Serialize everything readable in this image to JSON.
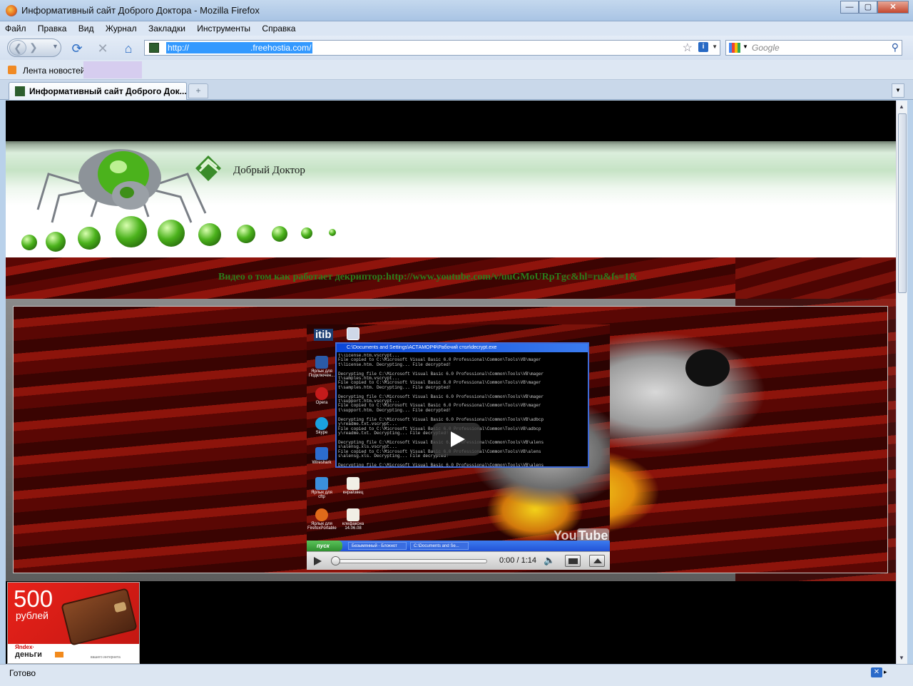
{
  "window": {
    "title": "Информативный сайт Доброго Доктора - Mozilla Firefox",
    "buttons": {
      "minimize": "—",
      "maximize": "▢",
      "close": "✕"
    }
  },
  "menu": [
    "Файл",
    "Правка",
    "Вид",
    "Журнал",
    "Закладки",
    "Инструменты",
    "Справка"
  ],
  "nav": {
    "url_prefix": "http://",
    "url_suffix": ".freehostia.com/",
    "search_placeholder": "Google"
  },
  "bookmarks": {
    "feed_label": "Лента новостей"
  },
  "tabs": [
    {
      "title": "Информативный сайт Доброго Док..."
    }
  ],
  "page": {
    "site_title": "Добрый Доктор",
    "video_caption": "Видео о том как работает декриптор:http://www.youtube.com/v/uuGMoURpTgc&hl=ru&fs=1&",
    "player": {
      "desktop_text": "itib",
      "cmd_title": "C:\\Documents and Settings\\АСТАМОРФ\\Рабочий стол\\decrypt.exe",
      "cmd_lines": [
        "t\\license.htm.vscrypt...",
        "File copied to C:\\Microsoft Visual Basic 6.0 Professional\\Common\\Tools\\VB\\mager",
        "t\\license.htm. Decrypting... File decrypted!",
        "",
        "Decrypting file C:\\Microsoft Visual Basic 6.0 Professional\\Common\\Tools\\VB\\mager",
        "t\\samples.htm.vscrypt...",
        "File copied to C:\\Microsoft Visual Basic 6.0 Professional\\Common\\Tools\\VB\\mager",
        "t\\samples.htm. Decrypting... File decrypted!",
        "",
        "Decrypting file C:\\Microsoft Visual Basic 6.0 Professional\\Common\\Tools\\VB\\mager",
        "t\\support.htm.vscrypt...",
        "File copied to C:\\Microsoft Visual Basic 6.0 Professional\\Common\\Tools\\VB\\mager",
        "t\\support.htm. Decrypting... File decrypted!",
        "",
        "Decrypting file C:\\Microsoft Visual Basic 6.0 Professional\\Common\\Tools\\VB\\adbcp",
        "y\\readme.txt.vscrypt...",
        "File copied to C:\\Microsoft Visual Basic 6.0 Professional\\Common\\Tools\\VB\\adbcp",
        "y\\readme.txt. Decrypting... File decrypted!",
        "",
        "Decrypting file C:\\Microsoft Visual Basic 6.0 Professional\\Common\\Tools\\VB\\alens",
        "s\\alensg.xls.vscrypt...",
        "File copied to C:\\Microsoft Visual Basic 6.0 Professional\\Common\\Tools\\VB\\alens",
        "s\\alensg.xls. Decrypting... File decrypted!",
        "",
        "Decrypting file C:\\Microsoft Visual Basic 6.0 Professional\\Common\\Tools\\VB\\alens"
      ],
      "desktop_icons": [
        "Ярлык для Подключен...",
        "Opera",
        "Skype",
        "Wireshark",
        "Ярлык для cftp",
        "кнрайзвец",
        "Ярлык для FirefoxPortable",
        "клефаксна 14.06.08"
      ],
      "taskbar_start": "пуск",
      "taskbar_tasks": [
        "Безымянный - Блокнот",
        "C:\\Documents and Se..."
      ],
      "youtube_logo_you": "You",
      "youtube_logo_tube": "Tube",
      "time": "0:00 / 1:14",
      "progress": 0
    },
    "ad": {
      "amount": "500",
      "currency": "рублей",
      "brand_top": "Яndex·",
      "brand_bottom": "деньги",
      "tagline": "вашего интернета"
    }
  },
  "status": {
    "text": "Готово"
  }
}
